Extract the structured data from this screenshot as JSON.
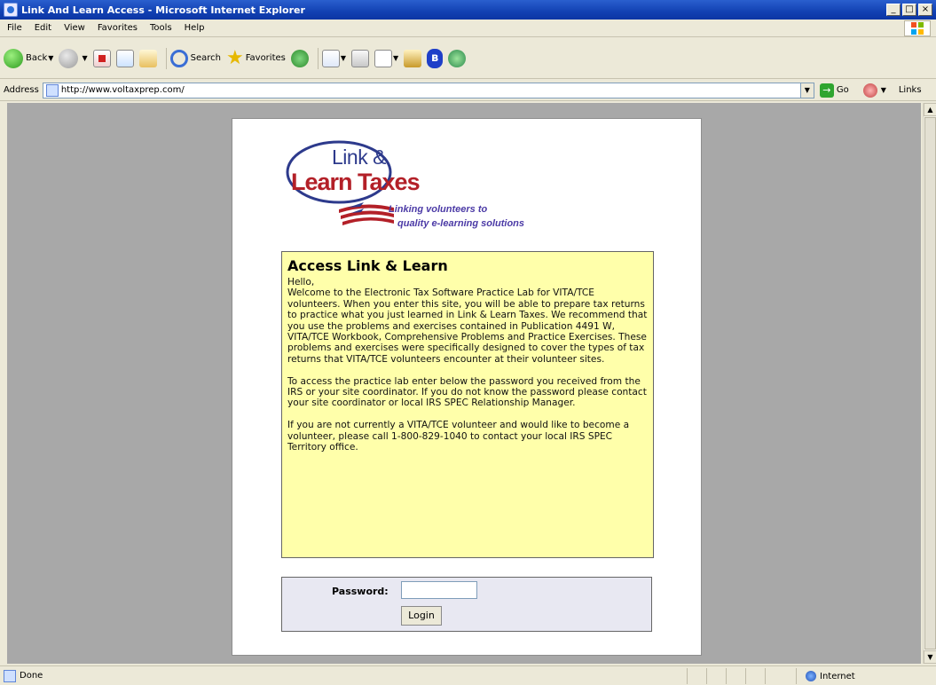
{
  "window": {
    "title": "Link And Learn Access - Microsoft Internet Explorer",
    "buttons": [
      "_",
      "□",
      "×"
    ]
  },
  "menu": [
    "File",
    "Edit",
    "View",
    "Favorites",
    "Tools",
    "Help"
  ],
  "toolbar": {
    "back_label": "Back",
    "search_label": "Search",
    "favorites_label": "Favorites"
  },
  "address": {
    "label": "Address",
    "url": "http://www.voltaxprep.com/",
    "go_label": "Go",
    "links_label": "Links"
  },
  "logo": {
    "line1": "Link &",
    "line2": "Learn Taxes",
    "tagline1": "Linking volunteers to",
    "tagline2": "quality e-learning solutions"
  },
  "access": {
    "title": "Access Link & Learn",
    "body": "Hello,\nWelcome to the Electronic Tax Software Practice Lab for VITA/TCE volunteers. When you enter this site, you will be able to prepare tax returns to practice what you just learned in Link & Learn Taxes. We recommend that you use the problems and exercises contained in Publication 4491 W, VITA/TCE Workbook, Comprehensive Problems and Practice Exercises. These problems and exercises were specifically designed to cover the types of tax returns that VITA/TCE volunteers encounter at their volunteer sites.\n\nTo access the practice lab enter below the password you received from the IRS or your site coordinator. If you do not know the password please contact your site coordinator or local IRS SPEC Relationship Manager.\n\nIf you are not currently a VITA/TCE volunteer and would like to become a volunteer, please call 1-800-829-1040 to contact your local IRS SPEC Territory office."
  },
  "login": {
    "password_label": "Password:",
    "password_value": "",
    "login_button": "Login"
  },
  "status": {
    "text": "Done",
    "zone": "Internet"
  },
  "colors": {
    "titlebar": "#0b35a3",
    "access_bg": "#ffffaa",
    "login_bg": "#e8e8f2",
    "logo_red": "#b32028",
    "logo_blue": "#2d3a8c"
  }
}
